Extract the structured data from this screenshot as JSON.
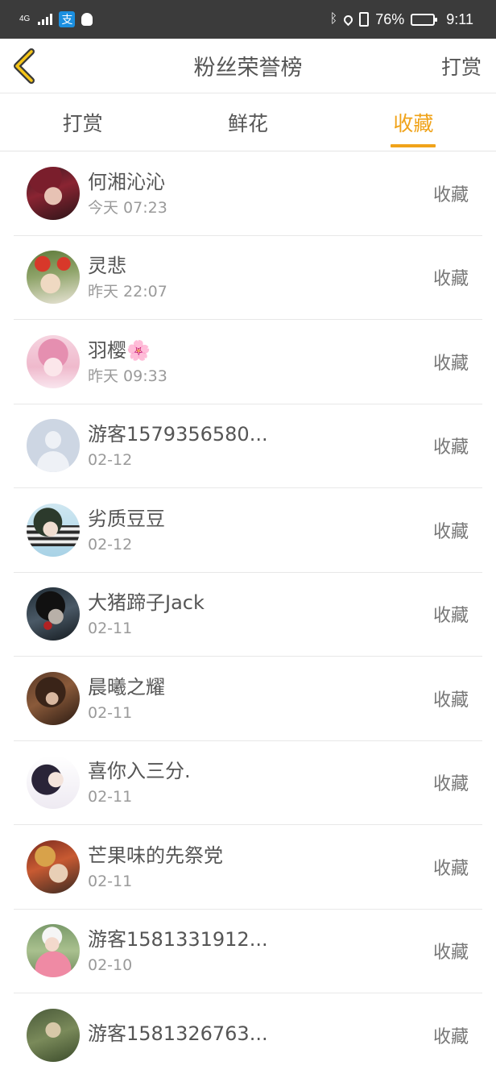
{
  "status_bar": {
    "network": "4G",
    "alipay_char": "支",
    "battery": "76%",
    "battery_level": 0.76,
    "time": "9:11",
    "icons": [
      "signal-icon",
      "alipay-icon",
      "qq-icon",
      "bluetooth-icon",
      "location-icon",
      "vibrate-icon",
      "battery-icon"
    ]
  },
  "nav": {
    "title": "粉丝荣誉榜",
    "action": "打赏"
  },
  "tabs": [
    {
      "label": "打赏",
      "active": false
    },
    {
      "label": "鲜花",
      "active": false
    },
    {
      "label": "收藏",
      "active": true
    }
  ],
  "colors": {
    "accent": "#f0a31a",
    "text": "#555555",
    "subtext": "#9a9a9a",
    "status_bar_bg": "#3b3b3b"
  },
  "list": [
    {
      "name": "何湘沁沁",
      "time": "今天 07:23",
      "action": "收藏",
      "avatar": "avatar-1"
    },
    {
      "name": "灵悲",
      "time": "昨天 22:07",
      "action": "收藏",
      "avatar": "avatar-2"
    },
    {
      "name": "羽樱🌸",
      "time": "昨天 09:33",
      "action": "收藏",
      "avatar": "avatar-3"
    },
    {
      "name": "游客1579356580...",
      "time": "02-12",
      "action": "收藏",
      "avatar": "default-avatar-icon"
    },
    {
      "name": "劣质豆豆",
      "time": "02-12",
      "action": "收藏",
      "avatar": "avatar-5"
    },
    {
      "name": "大猪蹄子Jack",
      "time": "02-11",
      "action": "收藏",
      "avatar": "avatar-6"
    },
    {
      "name": "晨曦之耀",
      "time": "02-11",
      "action": "收藏",
      "avatar": "avatar-7"
    },
    {
      "name": "喜你入三分.",
      "time": "02-11",
      "action": "收藏",
      "avatar": "avatar-8"
    },
    {
      "name": "芒果味的先祭党",
      "time": "02-11",
      "action": "收藏",
      "avatar": "avatar-9"
    },
    {
      "name": "游客1581331912...",
      "time": "02-10",
      "action": "收藏",
      "avatar": "avatar-10"
    },
    {
      "name": "游客1581326763...",
      "time": "",
      "action": "收藏",
      "avatar": "avatar-11"
    }
  ]
}
